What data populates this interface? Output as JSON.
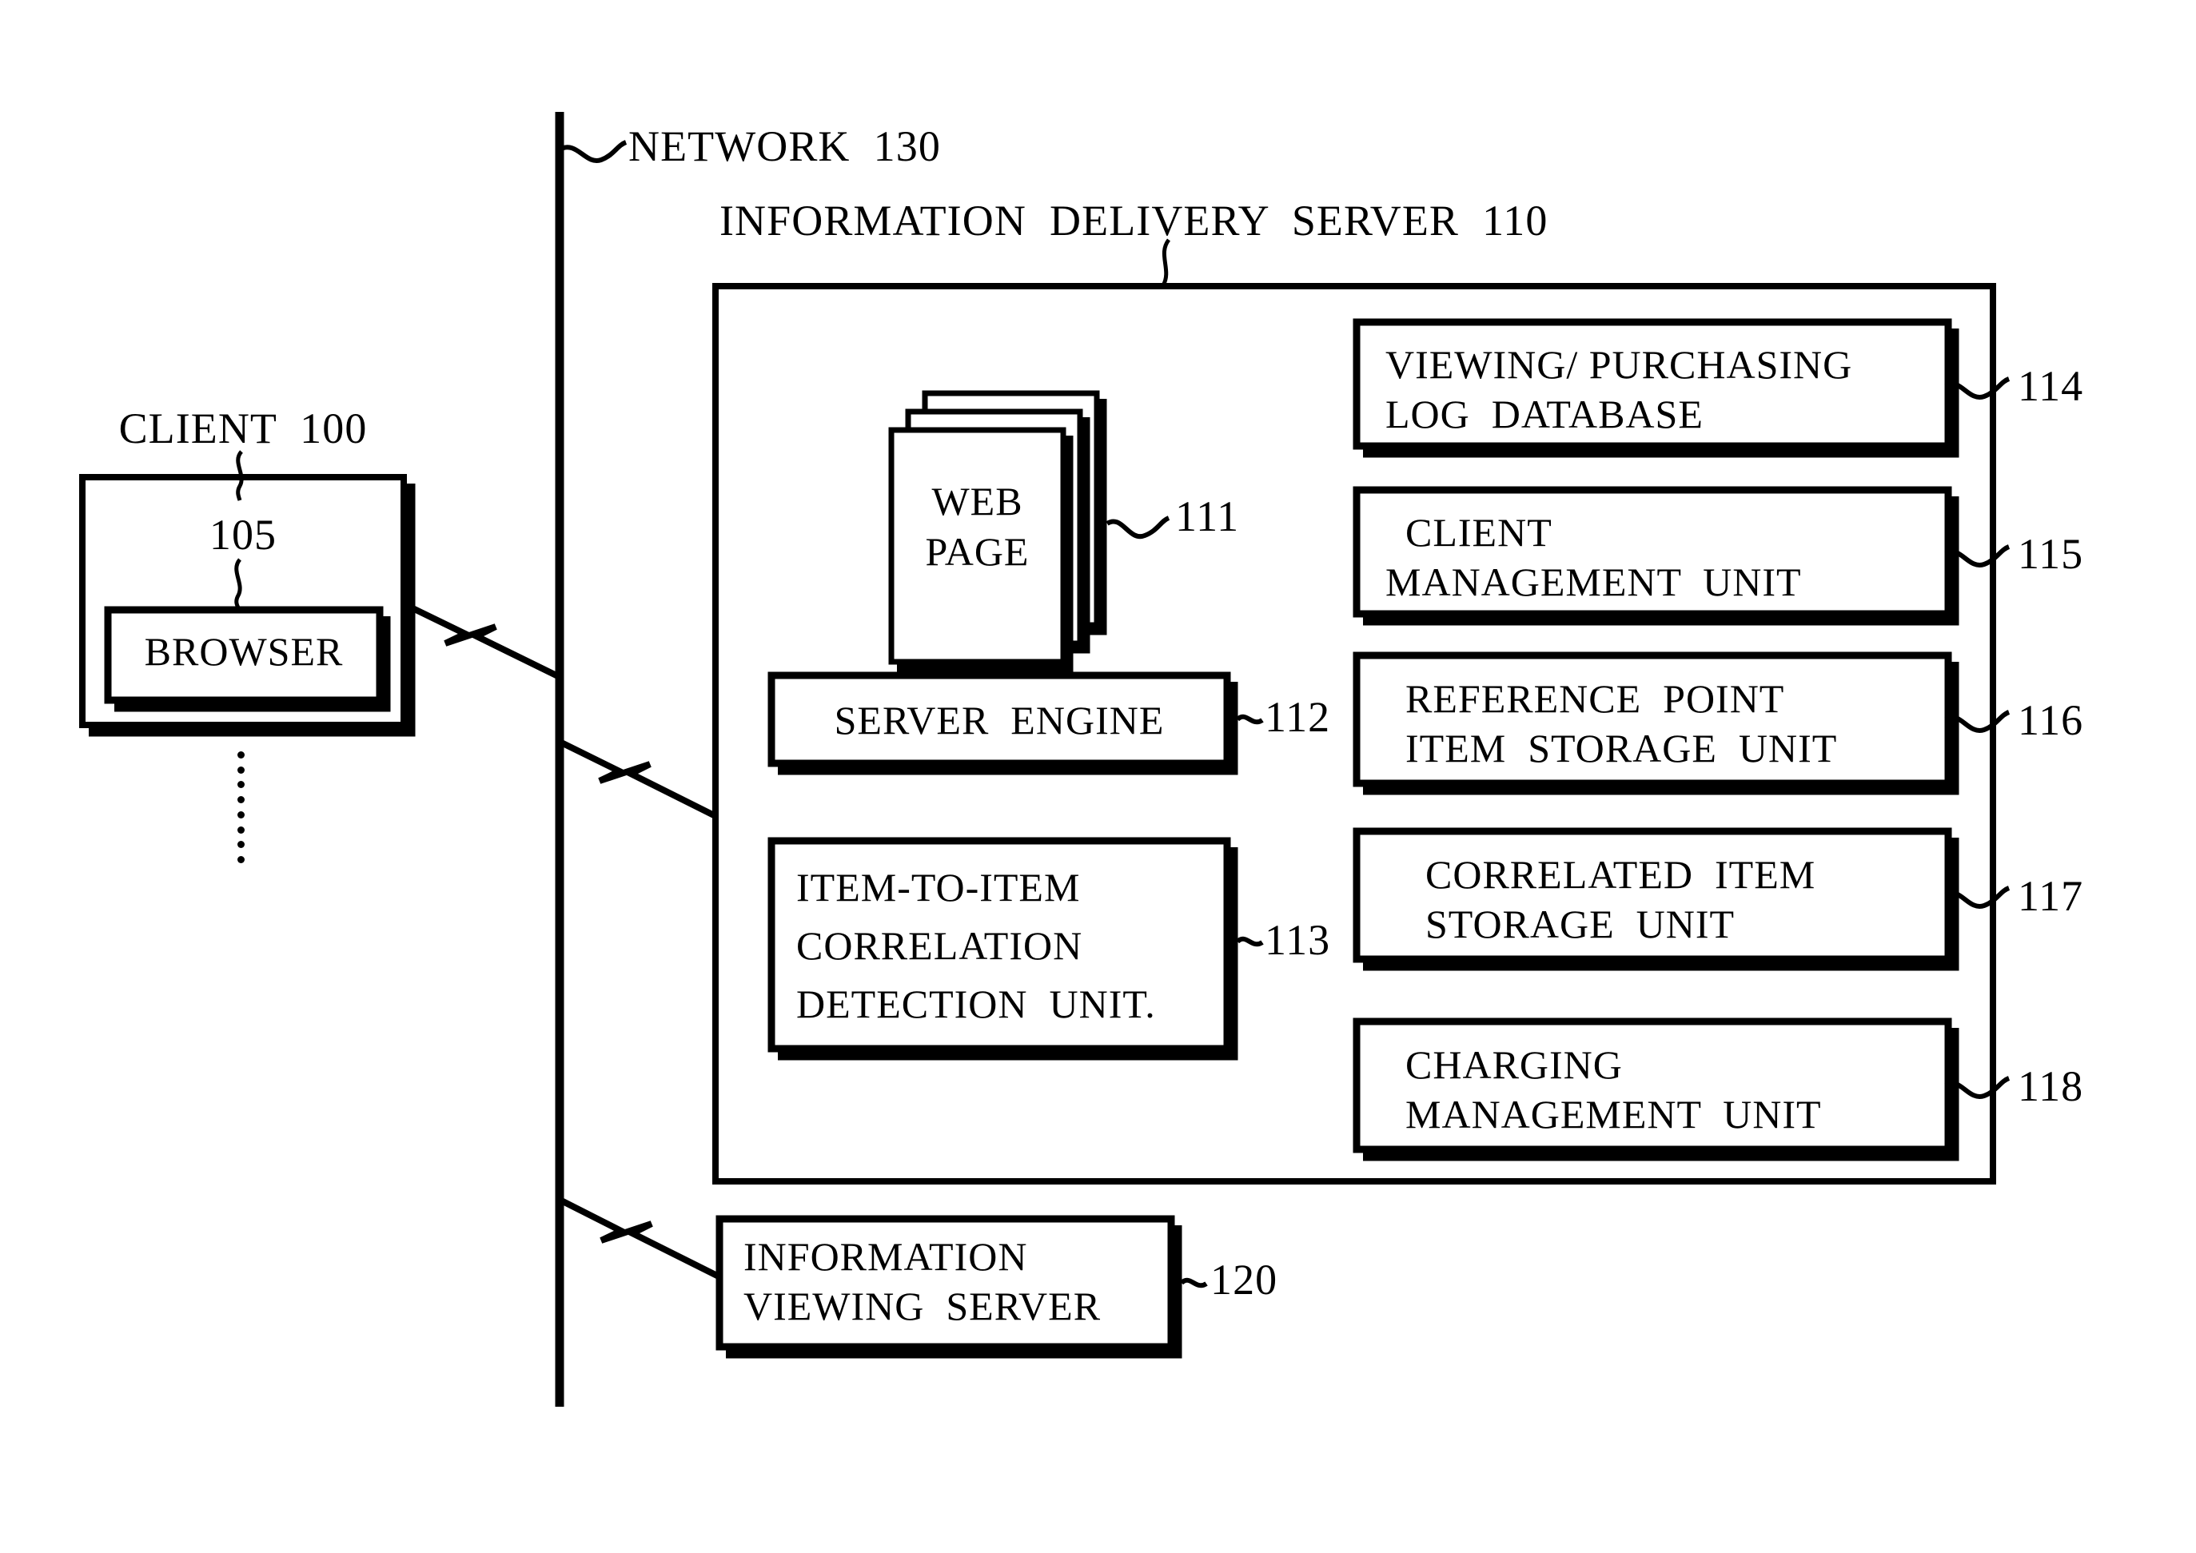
{
  "figure": {
    "network_label": "NETWORK  130",
    "server_title": "INFORMATION  DELIVERY  SERVER  110",
    "client_label": "CLIENT  100",
    "client_inner_ref": "105",
    "browser_label": "BROWSER"
  },
  "left_column": {
    "web_page": {
      "line1": "WEB",
      "line2": "PAGE",
      "ref": "111"
    },
    "server_engine": {
      "label": "SERVER  ENGINE",
      "ref": "112"
    },
    "correlation_unit": {
      "line1": "ITEM-TO-ITEM",
      "line2": "CORRELATION",
      "line3": "DETECTION  UNIT.",
      "ref": "113"
    }
  },
  "right_column": {
    "boxes": [
      {
        "line1": "VIEWING/ PURCHASING",
        "line2": "LOG  DATABASE",
        "ref": "114"
      },
      {
        "line1": "CLIENT",
        "line2": "MANAGEMENT  UNIT",
        "ref": "115"
      },
      {
        "line1": "REFERENCE  POINT",
        "line2": "ITEM  STORAGE  UNIT",
        "ref": "116"
      },
      {
        "line1": "CORRELATED  ITEM",
        "line2": "STORAGE  UNIT",
        "ref": "117"
      },
      {
        "line1": "CHARGING",
        "line2": "MANAGEMENT  UNIT",
        "ref": "118"
      }
    ]
  },
  "viewing_server": {
    "line1": "INFORMATION",
    "line2": "VIEWING  SERVER",
    "ref": "120"
  },
  "colors": {
    "ink": "#000000",
    "paper": "#ffffff"
  }
}
